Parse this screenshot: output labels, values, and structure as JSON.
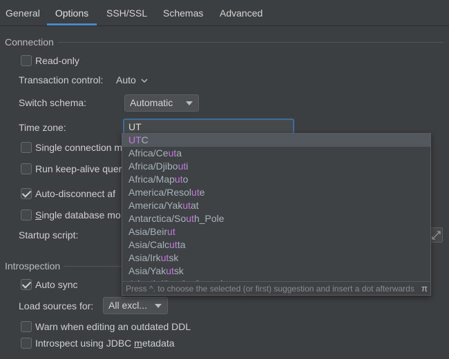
{
  "tabs": [
    {
      "label": "General",
      "active": false
    },
    {
      "label": "Options",
      "active": true
    },
    {
      "label": "SSH/SSL",
      "active": false
    },
    {
      "label": "Schemas",
      "active": false
    },
    {
      "label": "Advanced",
      "active": false
    }
  ],
  "connection": {
    "title": "Connection",
    "read_only": {
      "label": "Read-only",
      "checked": false
    },
    "transaction_control": {
      "label": "Transaction control:",
      "value": "Auto"
    },
    "switch_schema": {
      "label": "Switch schema:",
      "value": "Automatic"
    },
    "time_zone": {
      "label": "Time zone:",
      "value": "UT"
    },
    "single_connection": {
      "label": "Single connection m",
      "checked": false
    },
    "keep_alive": {
      "label": "Run keep-alive quer",
      "checked": false
    },
    "auto_disconnect": {
      "label": "Auto-disconnect af",
      "checked": true
    },
    "single_database": {
      "label_first": "S",
      "label_rest": "ingle database mo",
      "checked": false
    },
    "startup_script": {
      "label": "Startup script:"
    }
  },
  "introspection": {
    "title": "Introspection",
    "auto_sync": {
      "label": "Auto sync",
      "checked": true
    },
    "load_sources": {
      "label": "Load sources for:",
      "value": "All excl..."
    },
    "warn_outdated": {
      "label": "Warn when editing an outdated DDL",
      "checked": false
    },
    "introspect_jdbc": {
      "label_prefix": "Introspect using JDBC ",
      "label_mnemonic": "m",
      "label_suffix": "etadata",
      "checked": false
    }
  },
  "suggestions": {
    "items": [
      {
        "pre": "",
        "match": "UT",
        "post": "C",
        "selected": true
      },
      {
        "pre": "Africa/Ce",
        "match": "ut",
        "post": "a",
        "selected": false
      },
      {
        "pre": "Africa/Djibo",
        "match": "ut",
        "post": "i",
        "selected": false
      },
      {
        "pre": "Africa/Map",
        "match": "ut",
        "post": "o",
        "selected": false
      },
      {
        "pre": "America/Resol",
        "match": "ut",
        "post": "e",
        "selected": false
      },
      {
        "pre": "America/Yak",
        "match": "ut",
        "post": "at",
        "selected": false
      },
      {
        "pre": "Antarctica/So",
        "match": "ut",
        "post": "h_Pole",
        "selected": false
      },
      {
        "pre": "Asia/Beir",
        "match": "ut",
        "post": "",
        "selected": false
      },
      {
        "pre": "Asia/Calc",
        "match": "ut",
        "post": "ta",
        "selected": false
      },
      {
        "pre": "Asia/Irk",
        "match": "ut",
        "post": "sk",
        "selected": false
      },
      {
        "pre": "Asia/Yak",
        "match": "ut",
        "post": "sk",
        "selected": false
      },
      {
        "pre": "Atlantic/So",
        "match": "ut",
        "post": "h_Georgia",
        "selected": false
      }
    ],
    "footer_hint": "Press ^. to choose the selected (or first) suggestion and insert a dot afterwards",
    "footer_icon": "π"
  },
  "colors": {
    "background": "#3c3f41",
    "accent": "#4a88c7",
    "match_highlight": "#c678dd"
  }
}
